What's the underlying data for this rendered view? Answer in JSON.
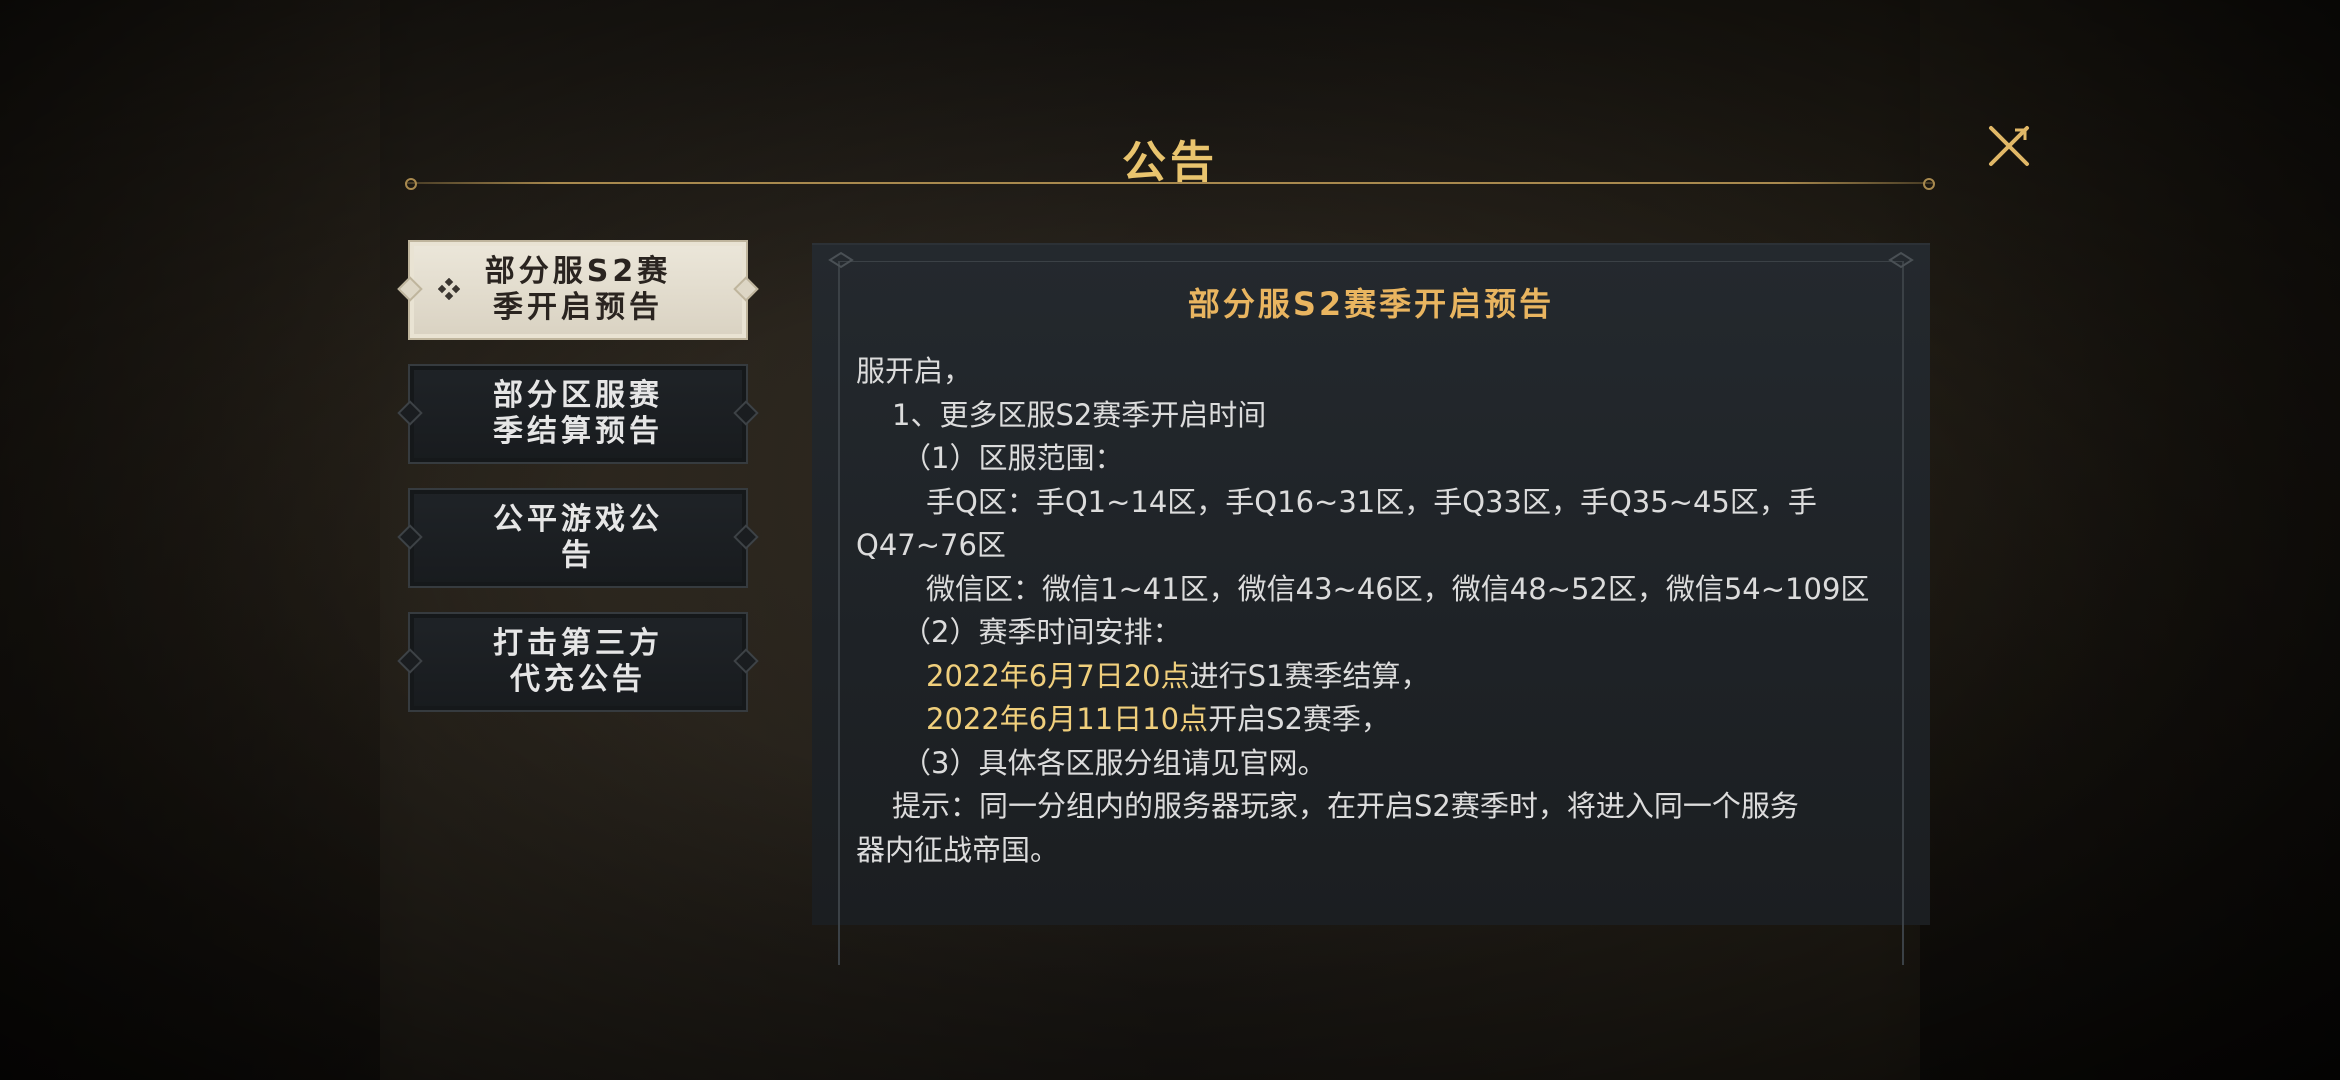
{
  "dialog": {
    "title": "公告",
    "close_icon": "close-x-icon"
  },
  "sidebar": {
    "items": [
      {
        "label": "部分服S2赛\n季开启预告",
        "active": true,
        "icon": "ornament-icon"
      },
      {
        "label": "部分区服赛\n季结算预告",
        "active": false
      },
      {
        "label": "公平游戏公\n告",
        "active": false
      },
      {
        "label": "打击第三方\n代充公告",
        "active": false
      }
    ]
  },
  "content": {
    "title": "部分服S2赛季开启预告",
    "lines": {
      "l1": "服开启，",
      "l2": "1、更多区服S2赛季开启时间",
      "l3": "（1）区服范围：",
      "l4": "手Q区：手Q1~14区，手Q16~31区，手Q33区，手Q35~45区，手",
      "l5": "Q47~76区",
      "l6": "微信区：微信1~41区，微信43~46区，微信48~52区，微信54~109区",
      "l7": "（2）赛季时间安排：",
      "l8a": "2022年6月7日20点",
      "l8b": "进行S1赛季结算，",
      "l9a": "2022年6月11日10点",
      "l9b": "开启S2赛季，",
      "l10": "（3）具体各区服分组请见官网。",
      "l11": "提示：同一分组内的服务器玩家，在开启S2赛季时，将进入同一个服务",
      "l12": "器内征战帝国。"
    }
  },
  "colors": {
    "accent_gold": "#e9c46e",
    "highlight": "#f0cf7c",
    "text": "#dcdcdc"
  }
}
